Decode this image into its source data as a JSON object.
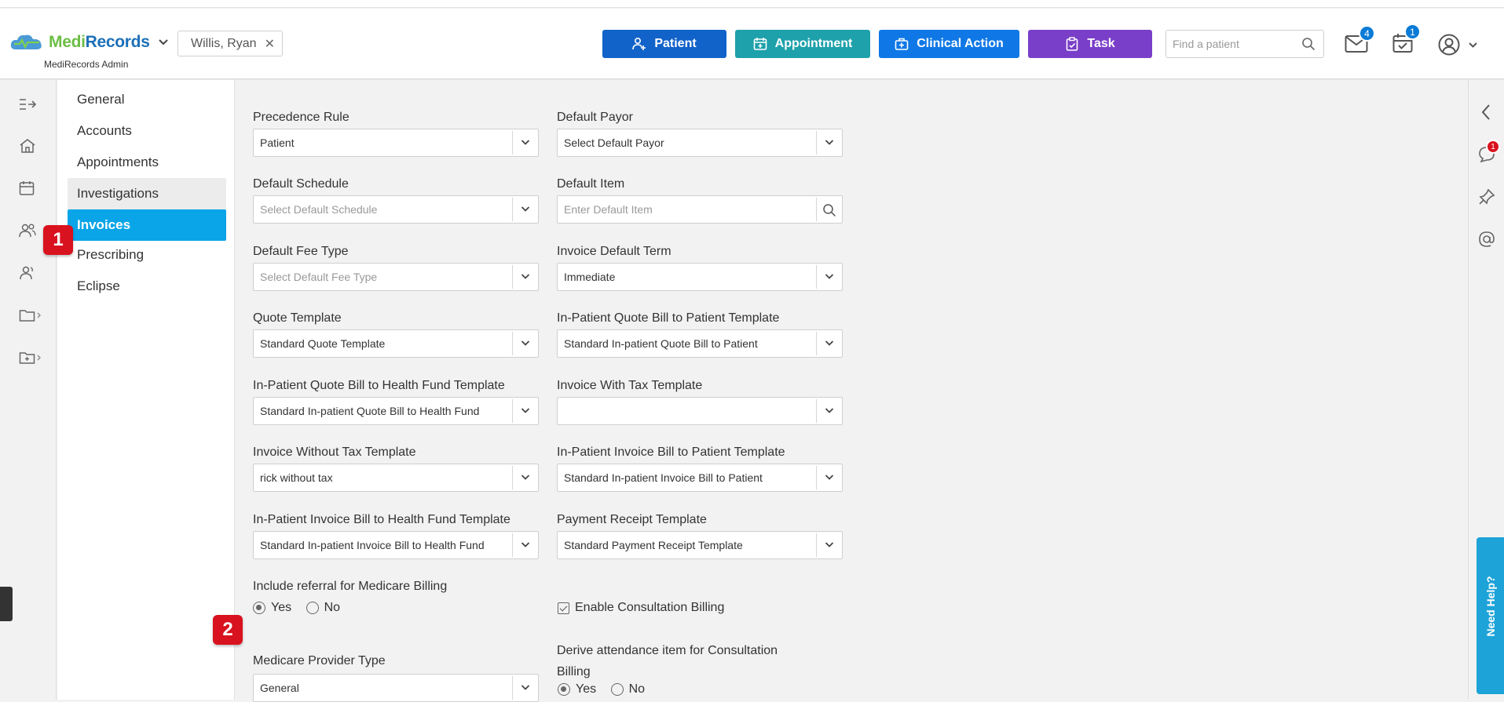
{
  "app": {
    "logo_part1": "Medi",
    "logo_part2": "Records",
    "subtitle": "MediRecords Admin"
  },
  "header": {
    "current_patient": "Willis, Ryan",
    "buttons": {
      "patient": "Patient",
      "appointment": "Appointment",
      "clinical_action": "Clinical Action",
      "task": "Task"
    },
    "search_placeholder": "Find a patient",
    "mail_count": "4",
    "tasks_count": "1"
  },
  "colors": {
    "patient_btn": "#1162c9",
    "appointment_btn": "#1ea1ab",
    "clinical_btn": "#0f78e6",
    "task_btn": "#7a3fc8",
    "active_nav": "#0aa5e8",
    "marker": "#d9121f"
  },
  "subnav": {
    "items": [
      "General",
      "Accounts",
      "Appointments",
      "Investigations",
      "Invoices",
      "Prescribing",
      "Eclipse"
    ],
    "active": "Invoices"
  },
  "form": {
    "precedence_rule": {
      "label": "Precedence Rule",
      "value": "Patient"
    },
    "default_payor": {
      "label": "Default Payor",
      "value": "Select Default Payor"
    },
    "default_schedule": {
      "label": "Default Schedule",
      "placeholder": "Select Default Schedule"
    },
    "default_item": {
      "label": "Default Item",
      "placeholder": "Enter Default Item"
    },
    "default_fee_type": {
      "label": "Default Fee Type",
      "placeholder": "Select Default Fee Type"
    },
    "invoice_default_term": {
      "label": "Invoice Default Term",
      "value": "Immediate"
    },
    "quote_template": {
      "label": "Quote Template",
      "value": "Standard Quote Template"
    },
    "inpatient_quote_patient": {
      "label": "In-Patient Quote Bill to Patient Template",
      "value": "Standard In-patient Quote Bill to Patient"
    },
    "inpatient_quote_fund": {
      "label": "In-Patient Quote Bill to Health Fund Template",
      "value": "Standard In-patient Quote Bill to Health Fund"
    },
    "invoice_with_tax": {
      "label": "Invoice With Tax Template",
      "value": ""
    },
    "invoice_without_tax": {
      "label": "Invoice Without Tax Template",
      "value": "rick without tax"
    },
    "inpatient_invoice_patient": {
      "label": "In-Patient Invoice Bill to Patient Template",
      "value": "Standard In-patient Invoice Bill to Patient"
    },
    "inpatient_invoice_fund": {
      "label": "In-Patient Invoice Bill to Health Fund Template",
      "value": "Standard In-patient Invoice Bill to Health Fund"
    },
    "payment_receipt": {
      "label": "Payment Receipt Template",
      "value": "Standard Payment Receipt Template"
    },
    "include_referral": {
      "label": "Include referral for Medicare Billing",
      "yes": "Yes",
      "no": "No",
      "selected": "Yes"
    },
    "enable_consultation": {
      "label": "Enable Consultation Billing",
      "checked": true
    },
    "medicare_provider_type": {
      "label": "Medicare Provider Type",
      "value": "General"
    },
    "derive_attendance": {
      "label_line1": "Derive attendance item for Consultation",
      "label_line2": "Billing",
      "yes": "Yes",
      "no": "No",
      "selected": "Yes"
    }
  },
  "markers": [
    "1",
    "2"
  ],
  "help_tab": "Need Help?",
  "notification_count": "1"
}
